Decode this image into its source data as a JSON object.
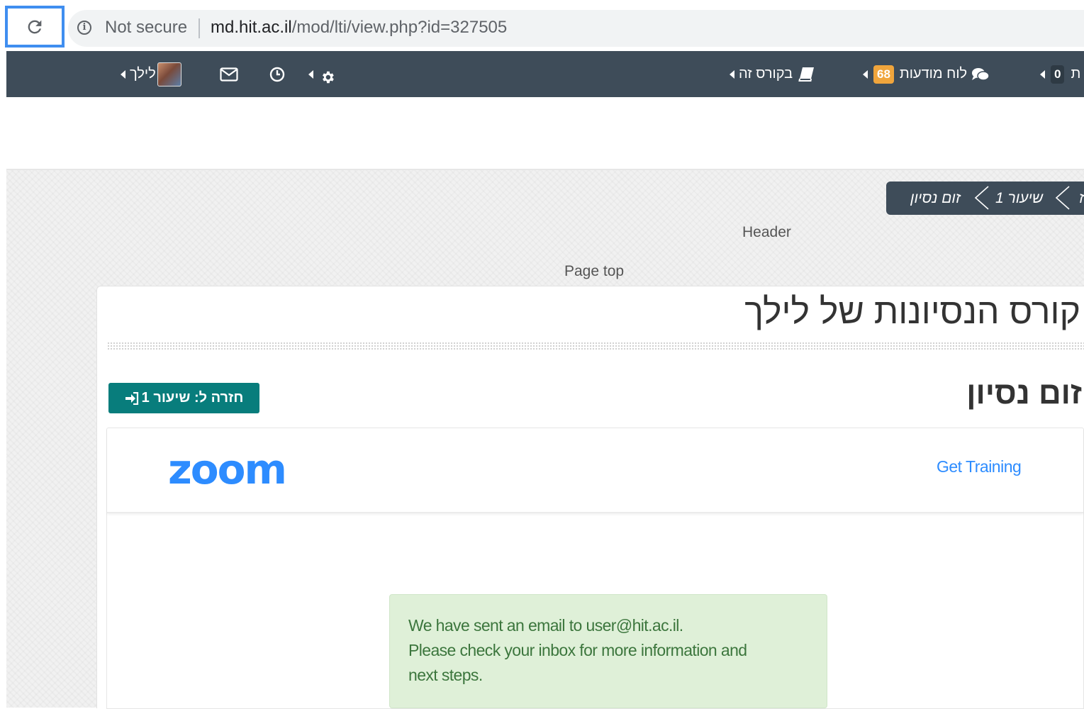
{
  "browser": {
    "security_label": "Not secure",
    "url_host": "md.hit.ac.il",
    "url_path": "/mod/lti/view.php?id=327505"
  },
  "navbar": {
    "user_name": "לילך",
    "course_menu_label": "בקורס זה",
    "message_board_label": "לוח מודעות",
    "message_board_count": "68",
    "other_count": "0",
    "cut_label": "ת"
  },
  "breadcrumb": {
    "items": [
      "ז",
      "שיעור 1",
      "זום נסיון"
    ]
  },
  "labels": {
    "header": "Header",
    "page_top": "Page top"
  },
  "course": {
    "title": "קורס הנסיונות של לילך",
    "activity_title": "זום נסיון",
    "back_button": "חזרה ל: שיעור 1"
  },
  "zoom": {
    "logo_text": "zoom",
    "get_training": "Get Training",
    "alert_lines": [
      "We have sent an email to  user@hit.ac.il.",
      "Please check your inbox for more information and",
      "next steps."
    ]
  },
  "colors": {
    "navbar_bg": "#3e4c59",
    "badge": "#f0a53c",
    "button_teal": "#087d7c",
    "zoom_blue": "#2d8cff",
    "alert_bg": "#dff0d8",
    "highlight_blue": "#3f8ef0"
  },
  "icons": {
    "reload": "reload-icon",
    "info": "info-icon",
    "mail": "mail-icon",
    "clock": "clock-icon",
    "gear": "gear-icon",
    "book": "book-icon",
    "chat": "chat-icon",
    "sign_in": "sign-in-icon"
  }
}
